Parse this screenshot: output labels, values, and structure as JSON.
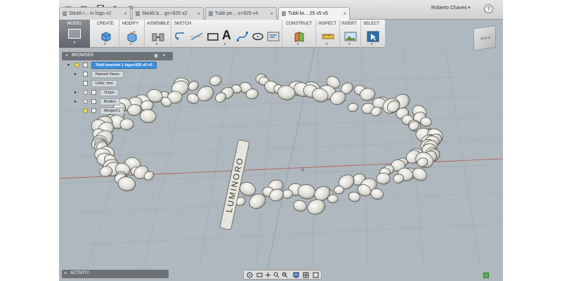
{
  "toolbar": {
    "file_glyph": "▦",
    "save_glyph": "🖫",
    "undo_glyph": "↶",
    "redo_glyph": "↷",
    "caret": "▾"
  },
  "tabs": [
    {
      "label": "Stickli r... m logo v2",
      "active": false
    },
    {
      "label": "Stickli b... gs+925 v2",
      "active": false
    },
    {
      "label": "Tubli pe... o+925 v4",
      "active": false
    },
    {
      "label": "Tubli br... 25 v5 v5",
      "active": true
    }
  ],
  "tab_close": "×",
  "user": {
    "name": "Roberto Chaves",
    "caret": "▾",
    "help": "?"
  },
  "ribbon": {
    "workspace": "MODEL",
    "groups": [
      "CREATE",
      "MODIFY",
      "ASSEMBLE",
      "SKETCH",
      "CONSTRUCT",
      "INSPECT",
      "INSERT",
      "SELECT"
    ],
    "caret": "▾",
    "sketch_text_tool": "A"
  },
  "viewcube": {
    "label": "BACK"
  },
  "browser": {
    "title": "BROWSER",
    "collapse_glyph": "◂",
    "pin_glyph": "◧",
    "more_glyph": "•",
    "root": "Tubli bracelet 1 logo+925 v5 v5",
    "nodes": [
      "Named Views",
      "Units: mm",
      "Origin",
      "Bodies",
      "Merged:1"
    ]
  },
  "activity": {
    "label": "ACTIVITY",
    "caret": "▸"
  },
  "colors": {
    "canvas": "#aeb8be",
    "grid": "#9ea9b0",
    "accent": "#3d8fdd",
    "ok": "#4fb34f"
  }
}
